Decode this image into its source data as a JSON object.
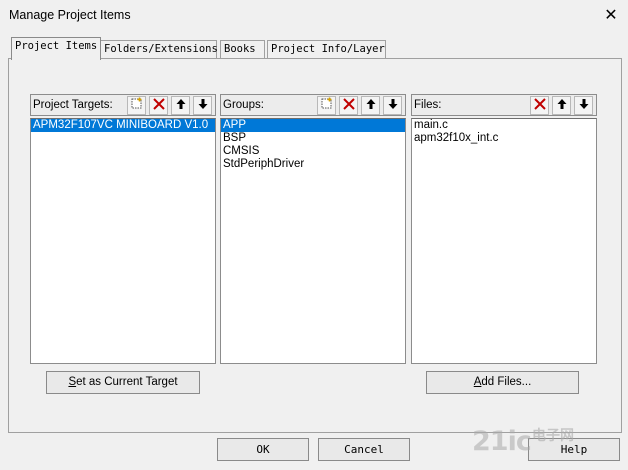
{
  "window": {
    "title": "Manage Project Items"
  },
  "tabs": [
    {
      "label": "Project Items"
    },
    {
      "label": "Folders/Extensions"
    },
    {
      "label": "Books"
    },
    {
      "label": "Project Info/Layer"
    }
  ],
  "targets": {
    "title": "Project Targets:",
    "items": [
      "APM32F107VC MINIBOARD V1.0"
    ],
    "selected_index": 0
  },
  "groups": {
    "title": "Groups:",
    "items": [
      "APP",
      "BSP",
      "CMSIS",
      "StdPeriphDriver"
    ],
    "selected_index": 0
  },
  "files": {
    "title": "Files:",
    "items": [
      "main.c",
      "apm32f10x_int.c"
    ]
  },
  "buttons": {
    "set_target_u": "S",
    "set_target_rest": "et as Current Target",
    "add_files_u": "A",
    "add_files_rest": "dd Files...",
    "ok": "OK",
    "cancel": "Cancel",
    "help": "Help"
  },
  "watermark": {
    "text": "21ic",
    "cn": "电子网"
  },
  "colors": {
    "selection": "#0078d7",
    "delete_icon": "#c00000"
  }
}
